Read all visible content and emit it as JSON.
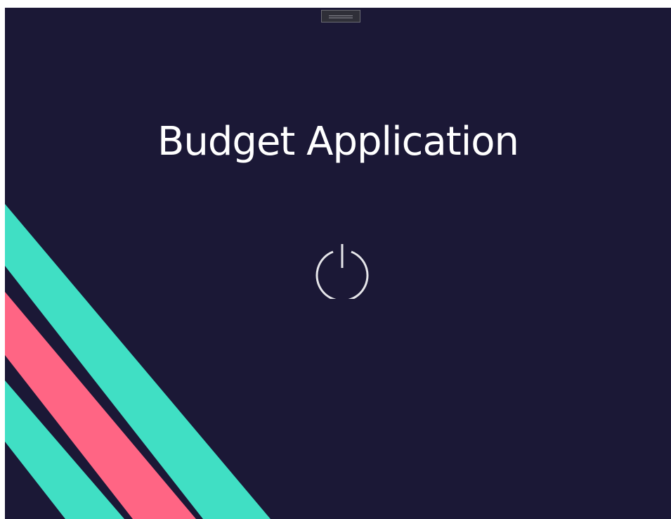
{
  "app": {
    "title": "Budget Application"
  },
  "window": {
    "background": "#1b1836"
  },
  "power_button": {
    "icon": "power-icon",
    "color": "#e6e6ea"
  },
  "decoration": {
    "stripe_colors": [
      "#40dfc4",
      "#ff6584",
      "#40dfc4"
    ]
  }
}
